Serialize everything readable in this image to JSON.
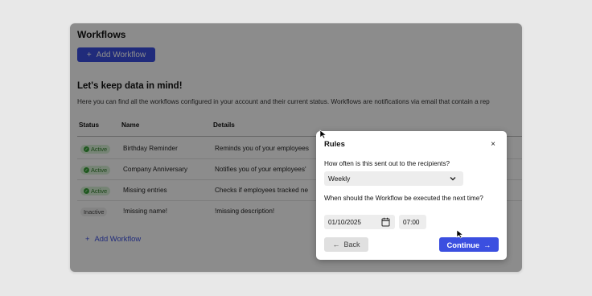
{
  "app": {
    "title": "Workflows",
    "add_button_plus": "+",
    "add_button_label": "Add Workflow",
    "heading": "Let's keep data in mind!",
    "description": "Here you can find all the workflows configured in your account and their current status. Workflows are notifications via email that contain a rep",
    "columns": {
      "status": "Status",
      "name": "Name",
      "details": "Details"
    },
    "rows": [
      {
        "status": "Active",
        "name": "Birthday Reminder",
        "details": "Reminds you of your employees"
      },
      {
        "status": "Active",
        "name": "Company Anniversary",
        "details": "Notifies you of your employees'"
      },
      {
        "status": "Active",
        "name": "Missing entries",
        "details": "Checks if employees tracked ne"
      },
      {
        "status": "Inactive",
        "name": "!missing name!",
        "details": "!missing description!"
      }
    ],
    "bottom_add_plus": "+",
    "bottom_add_label": "Add Workflow"
  },
  "modal": {
    "title": "Rules",
    "close": "×",
    "question_frequency": "How often is this sent out to the recipients?",
    "frequency_value": "Weekly",
    "question_time": "When should the Workflow be executed the next time?",
    "date_value": "01/10/2025",
    "time_value": "07:00",
    "back_arrow": "←",
    "back_label": "Back",
    "continue_label": "Continue",
    "continue_arrow": "→"
  },
  "colors": {
    "primary": "#3b4fe0",
    "active_badge_bg": "#d7f0d5",
    "active_badge_text": "#2f7d2a",
    "overlay": "rgba(0,0,0,0.45)"
  }
}
